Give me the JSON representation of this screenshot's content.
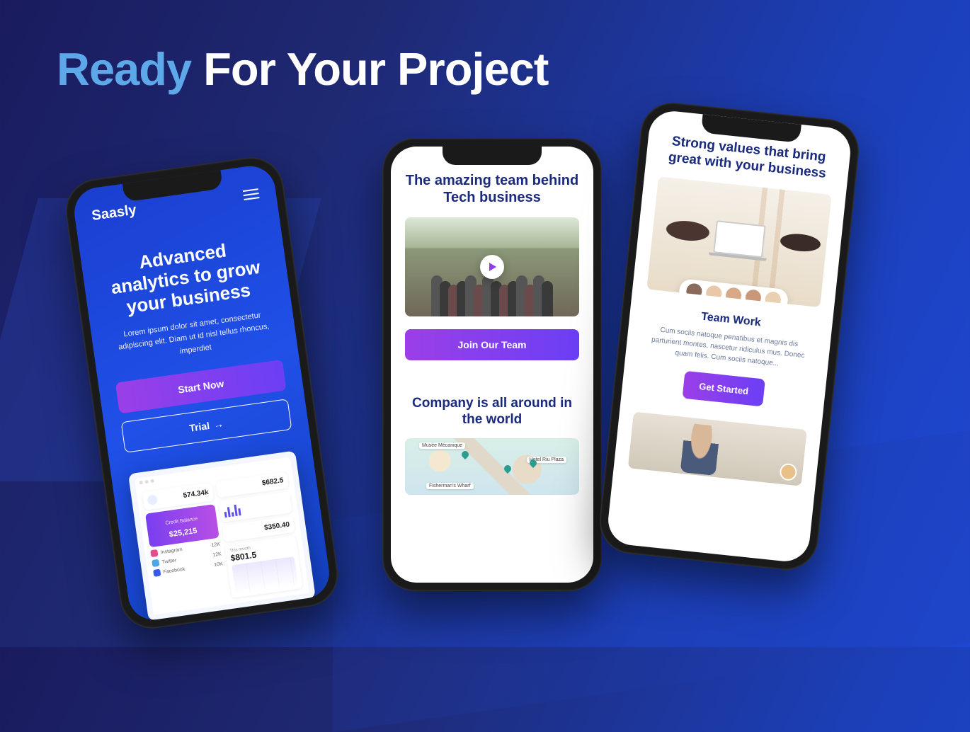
{
  "headline": {
    "accent": "Ready",
    "rest": " For Your Project"
  },
  "phone1": {
    "brand": "Saasly",
    "heading": "Advanced analytics to grow your business",
    "paragraph": "Lorem ipsum dolor sit amet, consectetur adipiscing elit. Diam ut id nisl tellus rhoncus, imperdiet",
    "cta_primary": "Start Now",
    "cta_secondary": "Trial",
    "dashboard": {
      "stat1_label": "574.34k",
      "stat2_value": "$682.5",
      "stat3_value": "$350.40",
      "balance_label": "Credit Balance",
      "balance_value": "$25,215",
      "profit_label": "This month",
      "profit_value": "$801.5",
      "social": [
        {
          "name": "Instagram",
          "value": "12K"
        },
        {
          "name": "Twitter",
          "value": "12K"
        },
        {
          "name": "Facebook",
          "value": "10K"
        }
      ]
    }
  },
  "phone2": {
    "heading": "The amazing team behind Tech business",
    "cta": "Join Our Team",
    "heading2": "Company is all around in the world",
    "map_labels": [
      "Musée Mécanique",
      "Hotel Riu Plaza",
      "Fisherman's Wharf"
    ]
  },
  "phone3": {
    "heading": "Strong values that bring great with your business",
    "subtitle": "Team Work",
    "paragraph": "Cum sociis natoque penatibus et magnis dis parturient montes, nascetur ridiculus mus. Donec quam felis. Cum sociis natoque...",
    "cta": "Get Started"
  }
}
